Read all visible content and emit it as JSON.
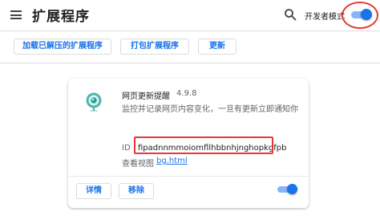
{
  "header": {
    "title": "扩展程序",
    "developer_mode_label": "开发者模式",
    "developer_mode_enabled": true
  },
  "toolbar": {
    "load_unpacked_label": "加载已解压的扩展程序",
    "pack_label": "打包扩展程序",
    "update_label": "更新"
  },
  "extension": {
    "name": "网页更新提醒",
    "version": "4.9.8",
    "description": "监控并记录网页内容变化，一旦有更新立即通知你",
    "id_label": "ID",
    "id": "fipadnnmmoiomfllhbbnhjnghopkgfpb",
    "views_label": "查看视图",
    "views_link": "bg.html",
    "details_label": "详情",
    "remove_label": "移除",
    "enabled": true
  },
  "colors": {
    "accent": "#1a73e8",
    "annotation": "#e53935"
  }
}
